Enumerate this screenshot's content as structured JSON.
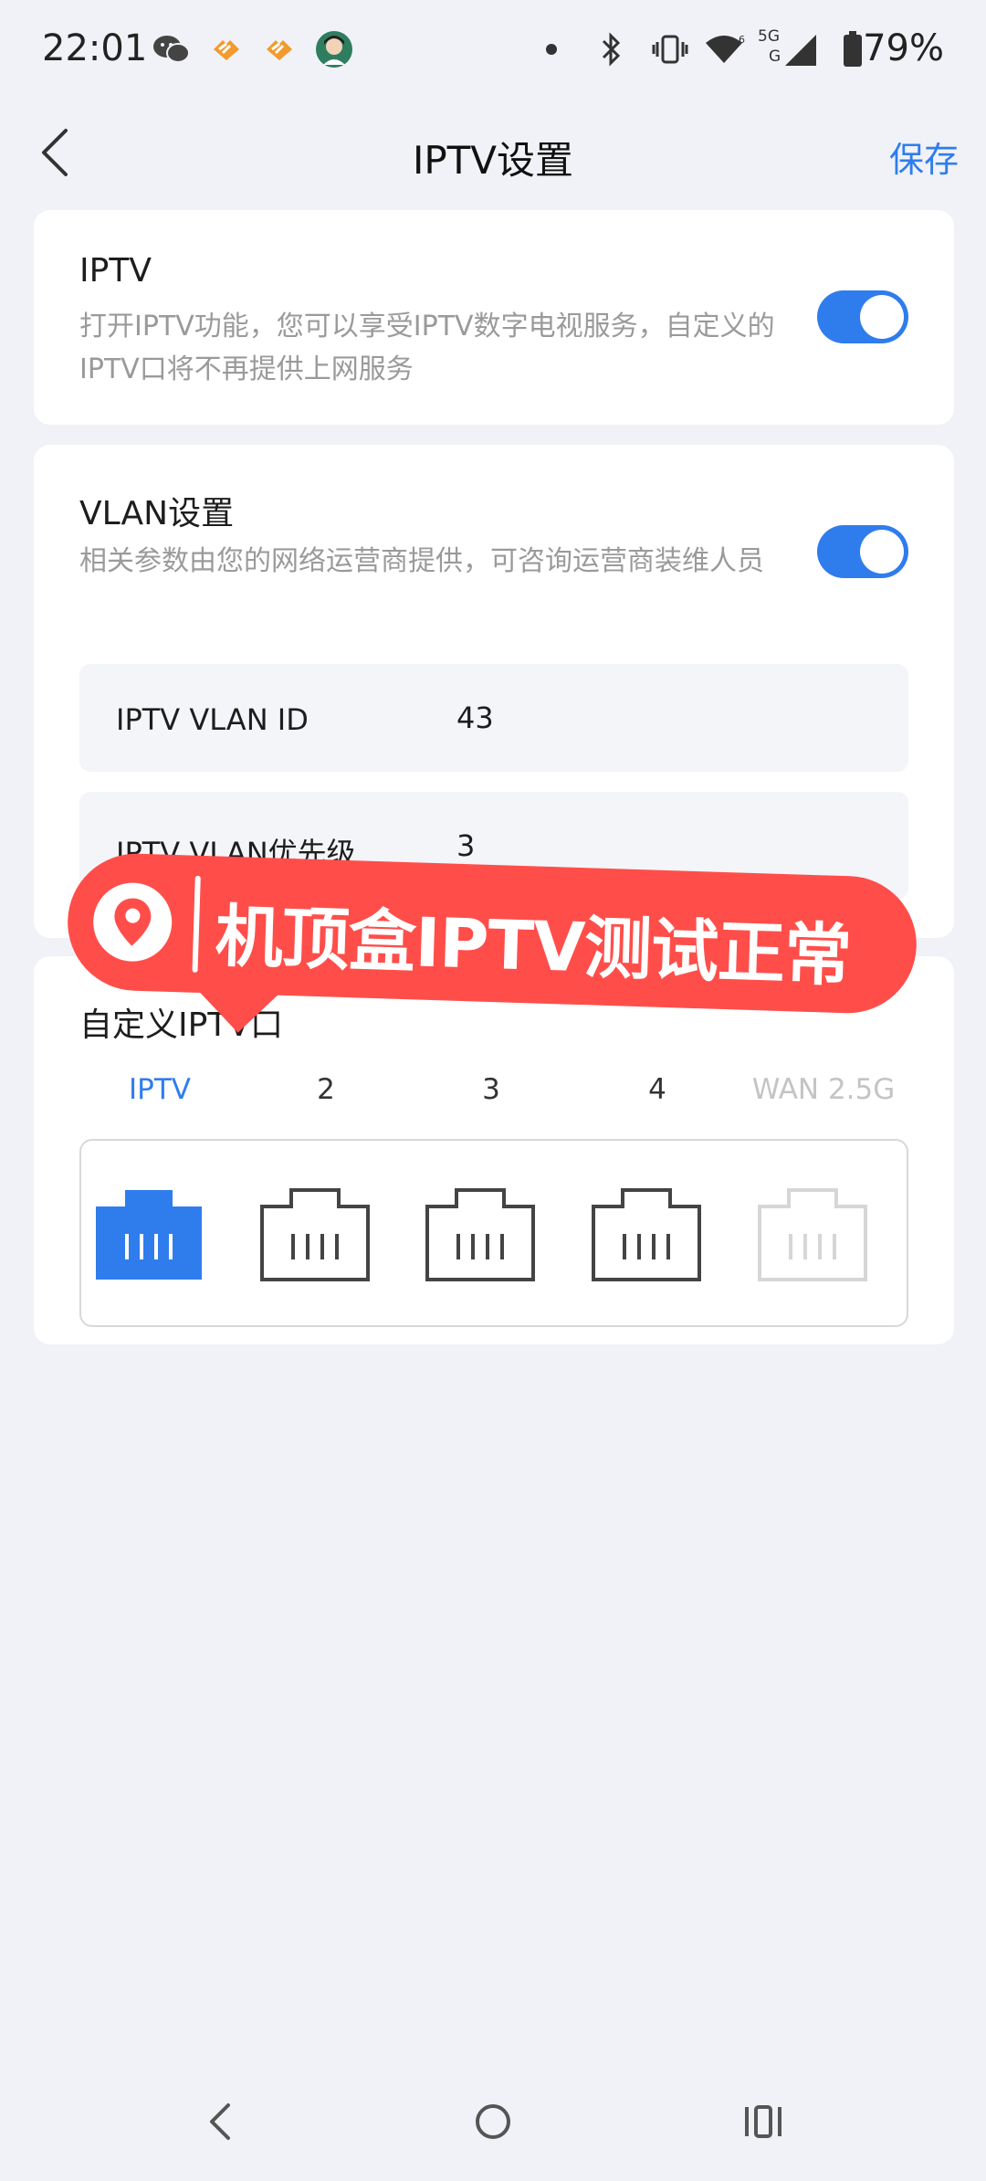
{
  "status_bar": {
    "time": "22:01",
    "network_label": "5G",
    "battery": "79%"
  },
  "header": {
    "title": "IPTV设置",
    "save_label": "保存"
  },
  "iptv_card": {
    "title": "IPTV",
    "description": "打开IPTV功能，您可以享受IPTV数字电视服务，自定义的IPTV口将不再提供上网服务",
    "enabled": true
  },
  "vlan_card": {
    "title": "VLAN设置",
    "description": "相关参数由您的网络运营商提供，可咨询运营商装维人员",
    "enabled": true,
    "fields": [
      {
        "label": "IPTV VLAN ID",
        "value": "43"
      },
      {
        "label": "IPTV VLAN优先级",
        "value": "3"
      }
    ]
  },
  "port_card": {
    "title": "自定义IPTV口",
    "ports": [
      {
        "label": "IPTV",
        "state": "selected"
      },
      {
        "label": "2",
        "state": "normal"
      },
      {
        "label": "3",
        "state": "normal"
      },
      {
        "label": "4",
        "state": "normal"
      },
      {
        "label": "WAN 2.5G",
        "state": "disabled"
      }
    ]
  },
  "banner": {
    "text": "机顶盒IPTV测试正常"
  },
  "colors": {
    "accent": "#2f7ded",
    "banner": "#ff4e4a"
  }
}
